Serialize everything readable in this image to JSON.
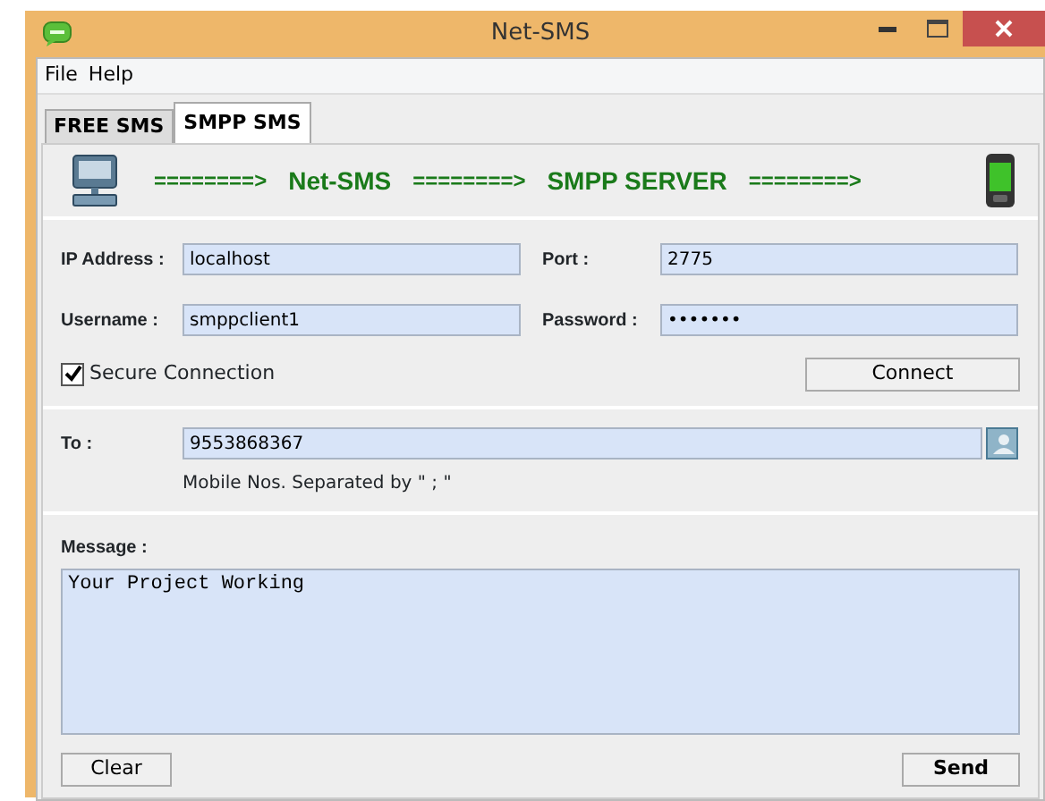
{
  "window": {
    "title": "Net-SMS"
  },
  "menu": [
    "File",
    "Help"
  ],
  "tabs": [
    {
      "label": "FREE SMS",
      "selected": false
    },
    {
      "label": "SMPP SMS",
      "selected": true
    }
  ],
  "banner": {
    "texts": [
      "========>",
      "Net-SMS",
      "========>",
      "SMPP SERVER",
      "========>"
    ]
  },
  "connection": {
    "ip_label": "IP Address :",
    "ip_value": "localhost",
    "port_label": "Port :",
    "port_value": "2775",
    "username_label": "Username :",
    "username_value": "smppclient1",
    "password_label": "Password :",
    "password_value": "•••••••",
    "secure": {
      "label": "Secure Connection",
      "checked": true
    },
    "connect_button": "Connect"
  },
  "recipients": {
    "label": "To :",
    "value": "9553868367",
    "hint": "Mobile Nos. Separated by \" ; \""
  },
  "message": {
    "label": "Message :",
    "value": "Your Project Working"
  },
  "buttons": {
    "clear": "Clear",
    "send": "Send"
  }
}
